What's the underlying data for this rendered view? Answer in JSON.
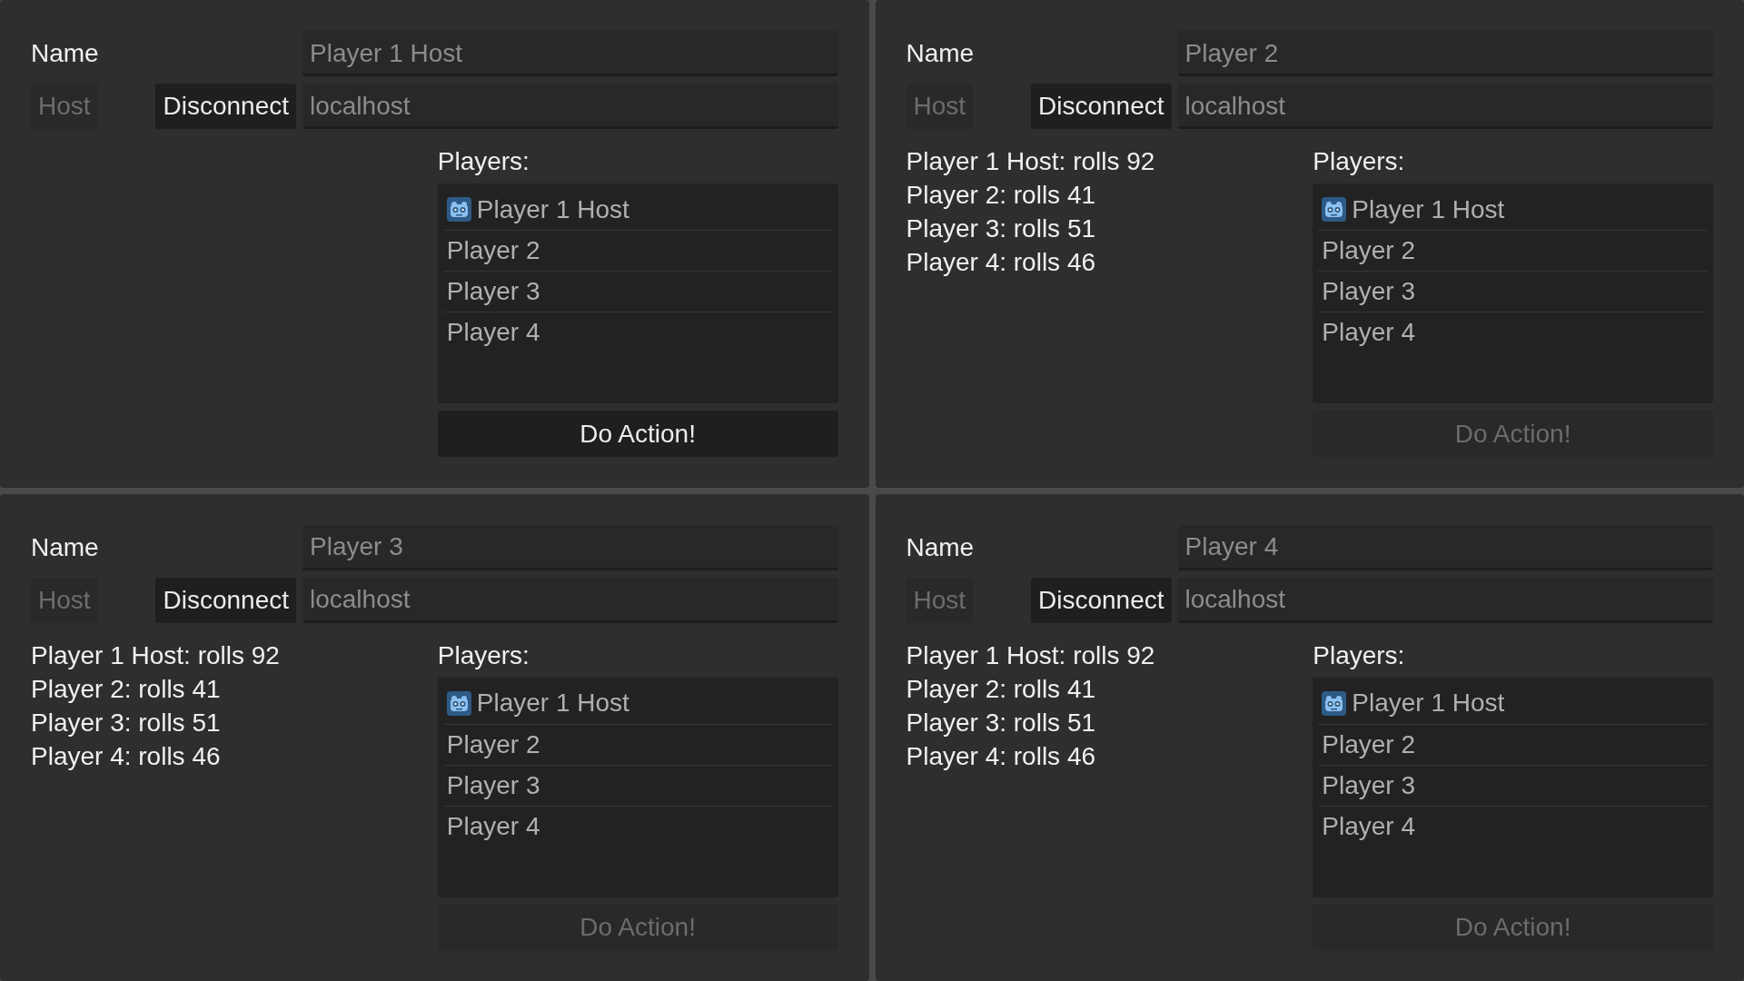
{
  "panels": [
    {
      "name_label": "Name",
      "name_field": {
        "value": "Player 1 Host",
        "disabled": true
      },
      "host_button": {
        "label": "Host",
        "disabled": true
      },
      "disconnect_button": {
        "label": "Disconnect",
        "disabled": false
      },
      "address_field": {
        "value": "localhost",
        "disabled": true
      },
      "players_label": "Players:",
      "players": [
        {
          "name": "Player 1 Host",
          "icon": true
        },
        {
          "name": "Player 2",
          "icon": false
        },
        {
          "name": "Player 3",
          "icon": false
        },
        {
          "name": "Player 4",
          "icon": false
        }
      ],
      "action_button": {
        "label": "Do Action!",
        "disabled": false
      }
    },
    {
      "name_label": "Name",
      "name_field": {
        "value": "Player 2",
        "disabled": true
      },
      "host_button": {
        "label": "Host",
        "disabled": true
      },
      "disconnect_button": {
        "label": "Disconnect",
        "disabled": false
      },
      "address_field": {
        "value": "localhost",
        "disabled": true
      },
      "rolls": [
        "Player 1 Host: rolls 92",
        "Player 2: rolls 41",
        "Player 3: rolls 51",
        "Player 4: rolls 46"
      ],
      "players_label": "Players:",
      "players": [
        {
          "name": "Player 1 Host",
          "icon": true
        },
        {
          "name": "Player 2",
          "icon": false
        },
        {
          "name": "Player 3",
          "icon": false
        },
        {
          "name": "Player 4",
          "icon": false
        }
      ],
      "action_button": {
        "label": "Do Action!",
        "disabled": true
      }
    },
    {
      "name_label": "Name",
      "name_field": {
        "value": "Player 3",
        "disabled": true
      },
      "host_button": {
        "label": "Host",
        "disabled": true
      },
      "disconnect_button": {
        "label": "Disconnect",
        "disabled": false
      },
      "address_field": {
        "value": "localhost",
        "disabled": true
      },
      "rolls": [
        "Player 1 Host: rolls 92",
        "Player 2: rolls 41",
        "Player 3: rolls 51",
        "Player 4: rolls 46"
      ],
      "players_label": "Players:",
      "players": [
        {
          "name": "Player 1 Host",
          "icon": true
        },
        {
          "name": "Player 2",
          "icon": false
        },
        {
          "name": "Player 3",
          "icon": false
        },
        {
          "name": "Player 4",
          "icon": false
        }
      ],
      "action_button": {
        "label": "Do Action!",
        "disabled": true
      }
    },
    {
      "name_label": "Name",
      "name_field": {
        "value": "Player 4",
        "disabled": true
      },
      "host_button": {
        "label": "Host",
        "disabled": true
      },
      "disconnect_button": {
        "label": "Disconnect",
        "disabled": false
      },
      "address_field": {
        "value": "localhost",
        "disabled": true
      },
      "rolls": [
        "Player 1 Host: rolls 92",
        "Player 2: rolls 41",
        "Player 3: rolls 51",
        "Player 4: rolls 46"
      ],
      "players_label": "Players:",
      "players": [
        {
          "name": "Player 1 Host",
          "icon": true
        },
        {
          "name": "Player 2",
          "icon": false
        },
        {
          "name": "Player 3",
          "icon": false
        },
        {
          "name": "Player 4",
          "icon": false
        }
      ],
      "action_button": {
        "label": "Do Action!",
        "disabled": true
      }
    }
  ]
}
